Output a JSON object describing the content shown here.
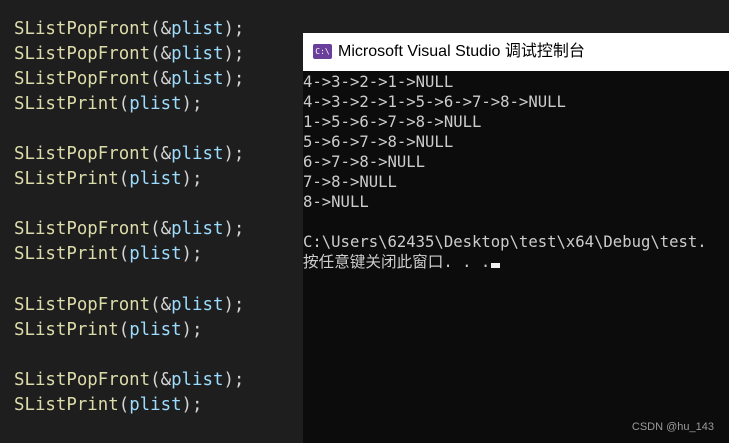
{
  "editor": {
    "lines": [
      {
        "fn": "SListPopFront",
        "open": "(&",
        "arg": "plist",
        "close": ");"
      },
      {
        "fn": "SListPopFront",
        "open": "(&",
        "arg": "plist",
        "close": ");"
      },
      {
        "fn": "SListPopFront",
        "open": "(&",
        "arg": "plist",
        "close": ");"
      },
      {
        "fn": "SListPrint",
        "open": "(",
        "arg": "plist",
        "close": ");"
      },
      {
        "fn": "SListPopFront",
        "open": "(&",
        "arg": "plist",
        "close": ");"
      },
      {
        "fn": "SListPrint",
        "open": "(",
        "arg": "plist",
        "close": ");"
      },
      {
        "fn": "SListPopFront",
        "open": "(&",
        "arg": "plist",
        "close": ");"
      },
      {
        "fn": "SListPrint",
        "open": "(",
        "arg": "plist",
        "close": ");"
      },
      {
        "fn": "SListPopFront",
        "open": "(&",
        "arg": "plist",
        "close": ");"
      },
      {
        "fn": "SListPrint",
        "open": "(",
        "arg": "plist",
        "close": ");"
      },
      {
        "fn": "SListPopFront",
        "open": "(&",
        "arg": "plist",
        "close": ");"
      },
      {
        "fn": "SListPrint",
        "open": "(",
        "arg": "plist",
        "close": ");"
      }
    ]
  },
  "console": {
    "icon_text": "C:\\",
    "icon_color": "#6a3f9c",
    "title": "Microsoft Visual Studio 调试控制台",
    "output": [
      "4->3->2->1->NULL",
      "4->3->2->1->5->6->7->8->NULL",
      "1->5->6->7->8->NULL",
      "5->6->7->8->NULL",
      "6->7->8->NULL",
      "7->8->NULL",
      "8->NULL",
      "",
      "C:\\Users\\62435\\Desktop\\test\\x64\\Debug\\test.",
      "按任意键关闭此窗口. . ."
    ]
  },
  "watermark": "CSDN @hu_143"
}
